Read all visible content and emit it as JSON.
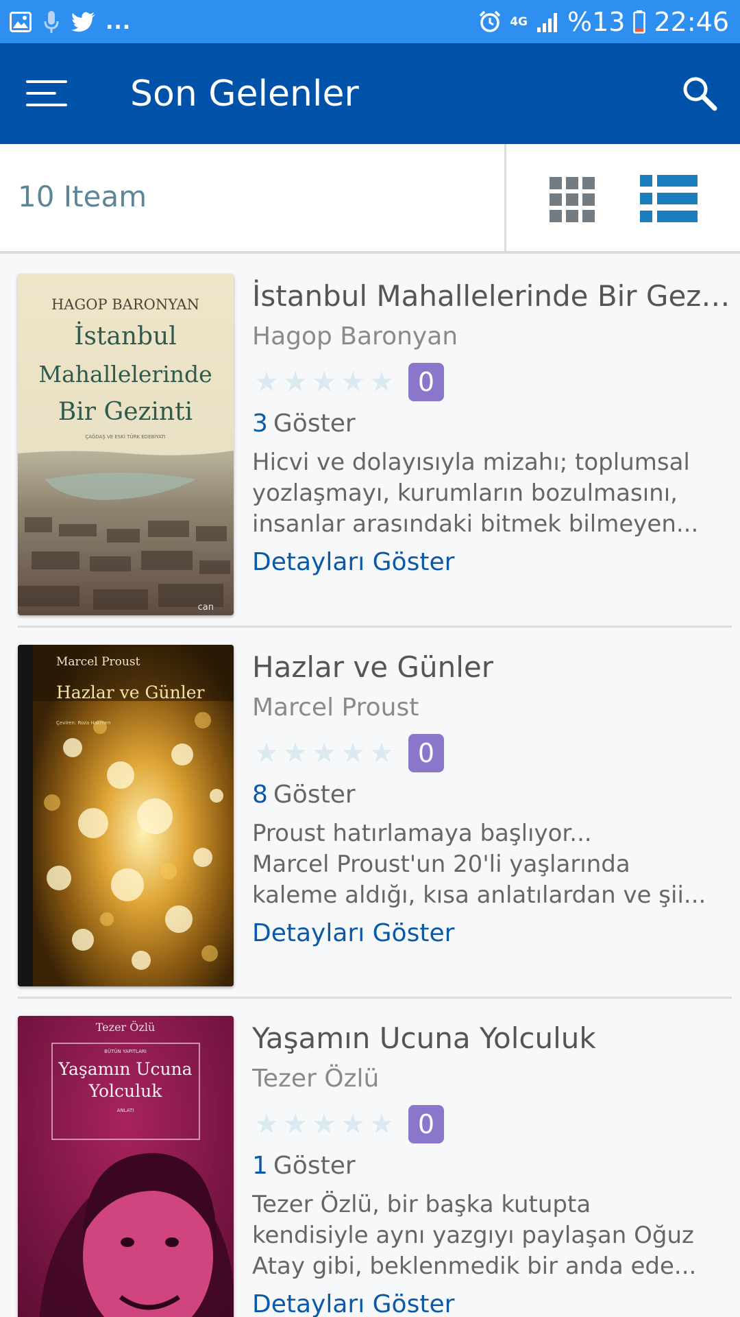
{
  "status_bar": {
    "battery_text": "%13",
    "time": "22:46",
    "network": "4G",
    "icons": [
      "image-icon",
      "mic-icon",
      "twitter-icon",
      "alarm-icon",
      "signal-icon",
      "battery-icon"
    ],
    "overflow": "..."
  },
  "toolbar": {
    "title": "Son Gelenler",
    "color": "#0052a8"
  },
  "list_header": {
    "count_label": "10 Iteam",
    "active_view": "list"
  },
  "books": [
    {
      "title": "İstanbul Mahallelerinde Bir Gezinti",
      "author": "Hagop Baronyan",
      "rating": 0,
      "views": "3",
      "views_label": "Göster",
      "description_lines": [
        "Hicvi ve dolayısıyla mizahı; toplumsal",
        "yozlaşmayı, kurumların bozulmasını,",
        "insanlar arasındaki bitmek bilmeyen..."
      ],
      "details_label": "Detayları Göster",
      "cover": {
        "author": "HAGOP BARONYAN",
        "title_lines": [
          "İstanbul",
          "Mahallelerinde",
          "Bir Gezinti"
        ],
        "subtitle": "ÇAĞDAŞ VE ESKİ TÜRK EDEBİYATI",
        "publisher": "can"
      }
    },
    {
      "title": "Hazlar ve Günler",
      "author": "Marcel Proust",
      "rating": 0,
      "views": "8",
      "views_label": "Göster",
      "description_lines": [
        "Proust hatırlamaya başlıyor...",
        "Marcel Proust'un 20'li yaşlarında",
        "kaleme aldığı, kısa anlatılardan ve şii..."
      ],
      "details_label": "Detayları Göster",
      "cover": {
        "author": "Marcel Proust",
        "title_lines": [
          "Hazlar ve Günler"
        ],
        "subtitle": "Çeviren: Roza Hakmen"
      }
    },
    {
      "title": "Yaşamın Ucuna Yolculuk",
      "author": "Tezer Özlü",
      "rating": 0,
      "views": "1",
      "views_label": "Göster",
      "description_lines": [
        "Tezer Özlü, bir başka kutupta",
        "kendisiyle aynı yazgıyı paylaşan Oğuz",
        "Atay gibi, beklenmedik bir anda ede..."
      ],
      "details_label": "Detayları Göster",
      "cover": {
        "author": "Tezer Özlü",
        "series": "BÜTÜN YAPITLARI",
        "title_lines": [
          "Yaşamın Ucuna",
          "Yolculuk"
        ],
        "genre": "ANLATI"
      }
    }
  ],
  "colors": {
    "accent": "#0a59a8",
    "status_bar": "#2f8ff0",
    "rating_badge": "#8a77cc",
    "star_empty": "#dbe9f1"
  }
}
